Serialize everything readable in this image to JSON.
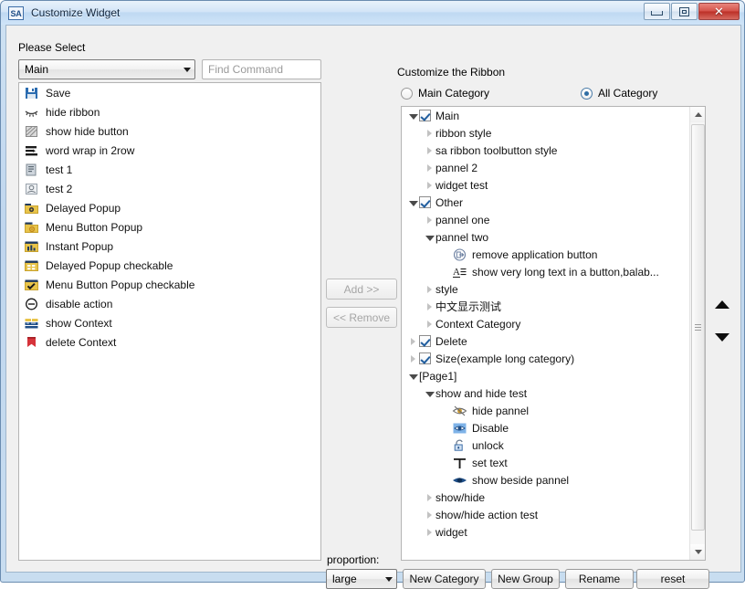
{
  "window": {
    "title": "Customize Widget",
    "app_icon_text": "SA",
    "buttons": {
      "minimize": "minimize-button",
      "maximize": "maximize-button",
      "close": "close-button",
      "close_glyph": "✕"
    }
  },
  "left_panel": {
    "heading": "Please Select",
    "category_combo": {
      "value": "Main"
    },
    "search": {
      "placeholder": "Find Command",
      "value": ""
    },
    "commands": [
      {
        "label": "Save",
        "icon": "floppy-disk-icon"
      },
      {
        "label": "hide ribbon",
        "icon": "hide-ribbon-icon"
      },
      {
        "label": "show hide button",
        "icon": "hatched-square-icon"
      },
      {
        "label": "word wrap in 2row",
        "icon": "word-wrap-icon"
      },
      {
        "label": "test 1",
        "icon": "document-icon"
      },
      {
        "label": "test 2",
        "icon": "card-icon"
      },
      {
        "label": "Delayed Popup",
        "icon": "folder-gear-icon"
      },
      {
        "label": "Menu Button Popup",
        "icon": "folder-dot-icon"
      },
      {
        "label": "Instant Popup",
        "icon": "folder-chart-icon"
      },
      {
        "label": "Delayed Popup checkable",
        "icon": "folder-grid-icon"
      },
      {
        "label": "Menu Button Popup checkable",
        "icon": "folder-check-icon"
      },
      {
        "label": "disable action",
        "icon": "minus-circle-icon"
      },
      {
        "label": "show Context",
        "icon": "context-table-icon"
      },
      {
        "label": "delete Context",
        "icon": "red-bookmark-icon"
      }
    ]
  },
  "transfer": {
    "add_label": "Add >>",
    "remove_label": "<< Remove",
    "add_enabled": false,
    "remove_enabled": false
  },
  "right_panel": {
    "heading": "Customize the Ribbon",
    "radios": [
      {
        "label": "Main Category",
        "checked": false
      },
      {
        "label": "All Category",
        "checked": true
      }
    ],
    "tree": [
      {
        "label": "Main",
        "indent": 0,
        "expander": "open",
        "checkbox": "checked"
      },
      {
        "label": "ribbon style",
        "indent": 1,
        "expander": "closed",
        "checkbox": "none"
      },
      {
        "label": "sa ribbon toolbutton style",
        "indent": 1,
        "expander": "closed",
        "checkbox": "none"
      },
      {
        "label": "pannel 2",
        "indent": 1,
        "expander": "closed",
        "checkbox": "none"
      },
      {
        "label": "widget test",
        "indent": 1,
        "expander": "closed",
        "checkbox": "none"
      },
      {
        "label": "Other",
        "indent": 0,
        "expander": "open",
        "checkbox": "checked"
      },
      {
        "label": "pannel one",
        "indent": 1,
        "expander": "closed",
        "checkbox": "none"
      },
      {
        "label": "pannel two",
        "indent": 1,
        "expander": "open",
        "checkbox": "none"
      },
      {
        "label": "remove application button",
        "indent": 2,
        "expander": "none",
        "checkbox": "none",
        "icon": "export-circle-icon"
      },
      {
        "label": "show very long text in a button,balab...",
        "indent": 2,
        "expander": "none",
        "checkbox": "none",
        "icon": "text-lines-icon"
      },
      {
        "label": "style",
        "indent": 1,
        "expander": "closed",
        "checkbox": "none"
      },
      {
        "label": "中文显示测试",
        "indent": 1,
        "expander": "closed",
        "checkbox": "none"
      },
      {
        "label": "Context Category",
        "indent": 1,
        "expander": "closed",
        "checkbox": "none"
      },
      {
        "label": "Delete",
        "indent": 0,
        "expander": "closed",
        "checkbox": "checked"
      },
      {
        "label": "Size(example long category)",
        "indent": 0,
        "expander": "closed",
        "checkbox": "checked"
      },
      {
        "label": "[Page1]",
        "indent": 0,
        "expander": "open",
        "checkbox": "none"
      },
      {
        "label": "show and hide test",
        "indent": 1,
        "expander": "open",
        "checkbox": "none"
      },
      {
        "label": "hide pannel",
        "indent": 2,
        "expander": "none",
        "checkbox": "none",
        "icon": "eye-hidden-icon"
      },
      {
        "label": "Disable",
        "indent": 2,
        "expander": "none",
        "checkbox": "none",
        "icon": "eye-blue-box-icon"
      },
      {
        "label": "unlock",
        "indent": 2,
        "expander": "none",
        "checkbox": "none",
        "icon": "unlock-icon"
      },
      {
        "label": "set text",
        "indent": 2,
        "expander": "none",
        "checkbox": "none",
        "icon": "text-t-icon"
      },
      {
        "label": "show beside pannel",
        "indent": 2,
        "expander": "none",
        "checkbox": "none",
        "icon": "eye-blue-icon"
      },
      {
        "label": "show/hide",
        "indent": 1,
        "expander": "closed",
        "checkbox": "none"
      },
      {
        "label": "show/hide action test",
        "indent": 1,
        "expander": "closed",
        "checkbox": "none"
      },
      {
        "label": "widget",
        "indent": 1,
        "expander": "closed",
        "checkbox": "none"
      }
    ],
    "move_up_icon": "triangle-up-icon",
    "move_down_icon": "triangle-down-icon"
  },
  "bottom_bar": {
    "proportion_label": "proportion:",
    "proportion_value": "large",
    "new_category": "New Category",
    "new_group": "New Group",
    "rename": "Rename",
    "reset": "reset"
  },
  "colors": {
    "accent": "#2f6ea5",
    "titlebar": "#cfe4f8",
    "close_button": "#bc2f27",
    "folder_icon": "#e8c44a"
  }
}
